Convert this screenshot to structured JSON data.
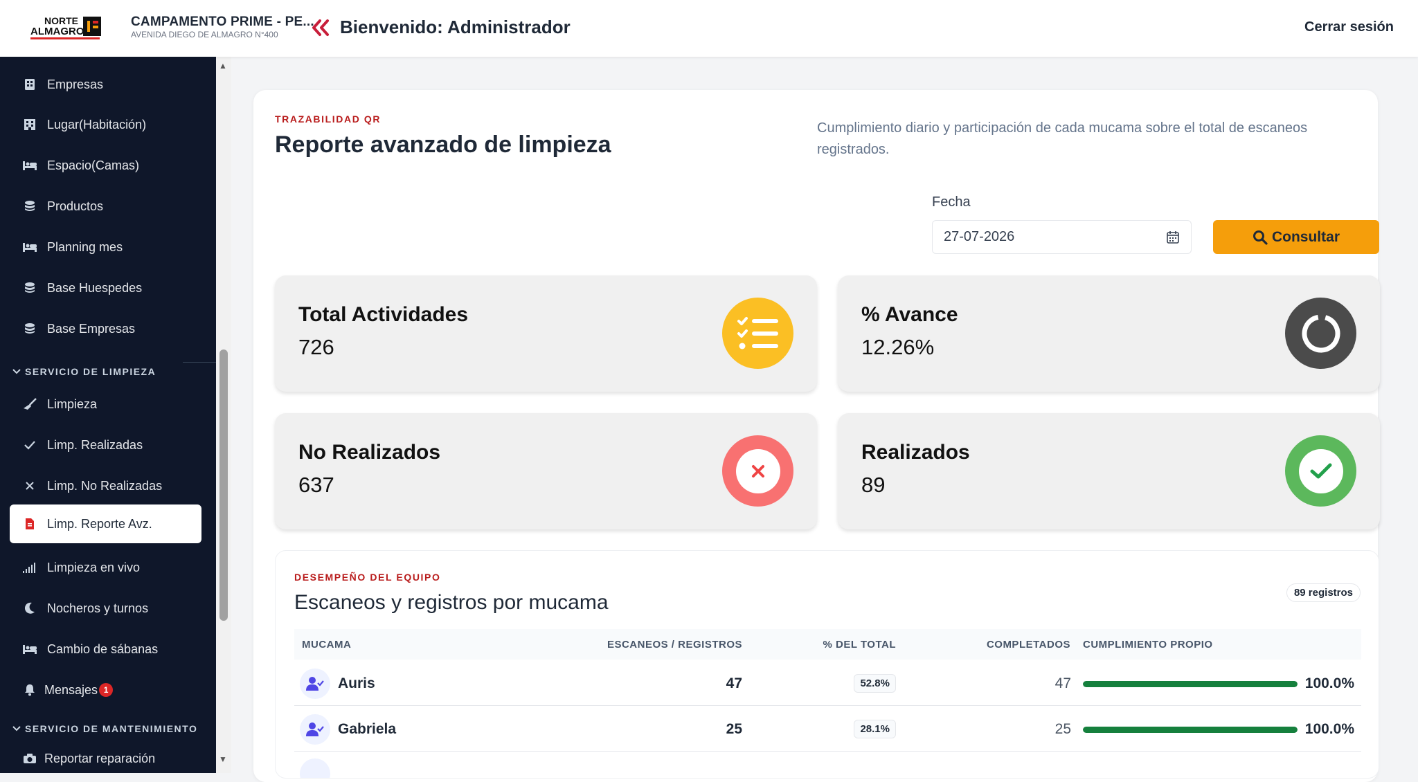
{
  "header": {
    "logo_text": [
      "NORTE",
      "ALMAGRO"
    ],
    "camp_name": "CAMPAMENTO PRIME - PE...",
    "camp_address": "AVENIDA DIEGO DE ALMAGRO N°400",
    "welcome": "Bienvenido: Administrador",
    "logout": "Cerrar sesión"
  },
  "sidebar": {
    "items": [
      {
        "label": "Empresas",
        "icon": "building-icon"
      },
      {
        "label": "Lugar(Habitación)",
        "icon": "hotel-icon"
      },
      {
        "label": "Espacio(Camas)",
        "icon": "bed-icon"
      },
      {
        "label": "Productos",
        "icon": "database-icon"
      },
      {
        "label": "Planning mes",
        "icon": "bed-icon"
      },
      {
        "label": "Base Huespedes",
        "icon": "database-icon"
      },
      {
        "label": "Base Empresas",
        "icon": "database-icon"
      }
    ],
    "section_cleaning": "SERVICIO DE LIMPIEZA",
    "cleaning_items": [
      {
        "label": "Limpieza",
        "icon": "broom-icon"
      },
      {
        "label": "Limp. Realizadas",
        "icon": "check-icon"
      },
      {
        "label": "Limp. No Realizadas",
        "icon": "x-icon"
      },
      {
        "label": "Limp. Reporte Avz.",
        "icon": "file-icon",
        "active": true
      },
      {
        "label": "Limpieza en vivo",
        "icon": "signal-icon"
      },
      {
        "label": "Nocheros y turnos",
        "icon": "moon-icon"
      },
      {
        "label": "Cambio de sábanas",
        "icon": "bed-icon"
      },
      {
        "label": "Mensajes",
        "icon": "bell-icon",
        "badge": "1"
      }
    ],
    "section_maintenance": "SERVICIO DE MANTENIMIENTO",
    "maintenance_items": [
      {
        "label": "Reportar reparación",
        "icon": "camera-icon"
      }
    ]
  },
  "report": {
    "eyebrow": "TRAZABILIDAD QR",
    "title": "Reporte avanzado de limpieza",
    "description": "Cumplimiento diario y participación de cada mucama sobre el total de escaneos registrados.",
    "date_label": "Fecha",
    "date_value": "27-07-2026",
    "consult_button": "Consultar"
  },
  "stats": [
    {
      "label": "Total Actividades",
      "value": "726",
      "color": "#fbbf24",
      "icon": "list-check-icon"
    },
    {
      "label": "% Avance",
      "value": "12.26%",
      "color": "#4b4b4b",
      "icon": "progress-ring-icon"
    },
    {
      "label": "No Realizados",
      "value": "637",
      "color": "#f87171",
      "icon": "x-circle-icon"
    },
    {
      "label": "Realizados",
      "value": "89",
      "color": "#5cb85c",
      "icon": "check-circle-icon"
    }
  ],
  "team": {
    "eyebrow": "DESEMPEÑO DEL EQUIPO",
    "title": "Escaneos y registros por mucama",
    "records_pill": "89 registros",
    "columns": [
      "MUCAMA",
      "ESCANEOS / REGISTROS",
      "% DEL TOTAL",
      "COMPLETADOS",
      "CUMPLIMIENTO PROPIO"
    ],
    "rows": [
      {
        "name": "Auris",
        "scans": "47",
        "pct_total": "52.8%",
        "completed": "47",
        "compliance": "100.0%",
        "compliance_value": 100
      },
      {
        "name": "Gabriela",
        "scans": "25",
        "pct_total": "28.1%",
        "completed": "25",
        "compliance": "100.0%",
        "compliance_value": 100
      }
    ]
  },
  "colors": {
    "sidebar_bg": "#0f172a",
    "accent_red": "#b91c1c",
    "button_orange": "#f59e0b",
    "bar_green": "#15803d"
  }
}
